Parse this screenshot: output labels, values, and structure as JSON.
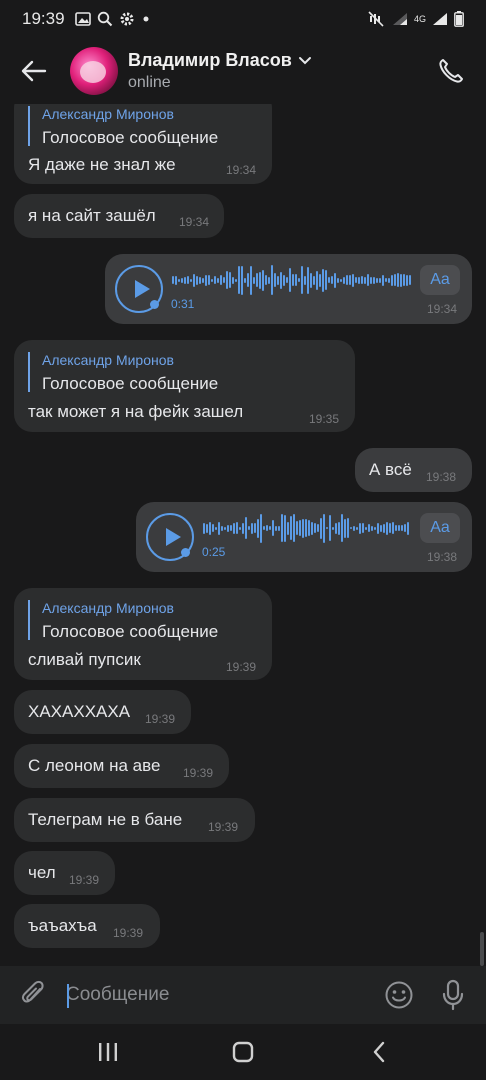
{
  "status_bar": {
    "time": "19:39",
    "network": "4G",
    "icons": [
      "gallery-icon",
      "search-icon",
      "settings-gear-icon",
      "notification-dot-icon",
      "mute-icon",
      "signal-icon",
      "battery-icon"
    ]
  },
  "header": {
    "contact_name": "Владимир Власов",
    "status": "online",
    "avatar_color": "#e0207a"
  },
  "messages": [
    {
      "reply_author": "Александр Миронов",
      "reply_text": "Голосовое сообщение",
      "text": "Я даже не знал же",
      "time": "19:34",
      "direction": "in"
    },
    {
      "text": "я на сайт зашёл",
      "time": "19:34",
      "direction": "in"
    },
    {
      "voice_duration": "0:31",
      "transcribe_label": "Aa",
      "time": "19:34",
      "direction": "out"
    },
    {
      "reply_author": "Александр Миронов",
      "reply_text": "Голосовое сообщение",
      "text": "так может я на фейк зашел",
      "time": "19:35",
      "direction": "in"
    },
    {
      "text": "А всё",
      "time": "19:38",
      "direction": "out"
    },
    {
      "voice_duration": "0:25",
      "transcribe_label": "Aa",
      "time": "19:38",
      "direction": "out"
    },
    {
      "reply_author": "Александр Миронов",
      "reply_text": "Голосовое сообщение",
      "text": "сливай пупсик",
      "time": "19:39",
      "direction": "in"
    },
    {
      "text": "ХАХАХХАХА",
      "time": "19:39",
      "direction": "in"
    },
    {
      "text": "С леоном на аве",
      "time": "19:39",
      "direction": "in"
    },
    {
      "text": "Телеграм не в бане",
      "time": "19:39",
      "direction": "in"
    },
    {
      "text": "чел",
      "time": "19:39",
      "direction": "in"
    },
    {
      "text": "ъаъахъа",
      "time": "19:39",
      "direction": "in"
    }
  ],
  "composer": {
    "placeholder": "Сообщение",
    "value": ""
  },
  "colors": {
    "background": "#19191a",
    "bubble_in": "#2c2d2e",
    "bubble_out": "#3b3c3e",
    "accent": "#5b9be6"
  }
}
